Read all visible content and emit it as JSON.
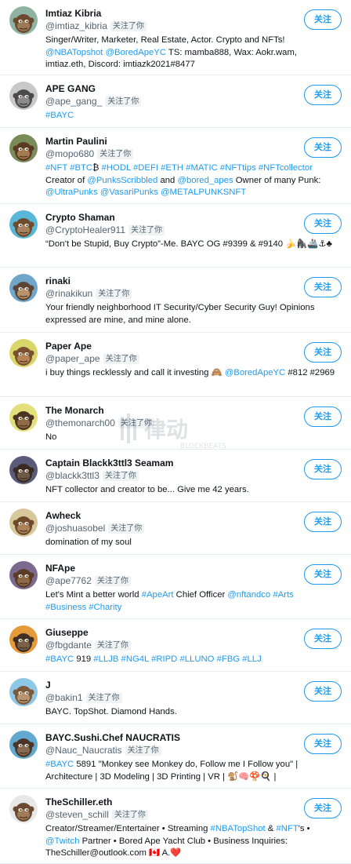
{
  "follow_label": "关注",
  "follows_you_label": "关注了你",
  "watermark": {
    "text": "律动",
    "subtext": "BLOCKBEATS"
  },
  "colors": {
    "link": "#1d9bf0",
    "divider": "#e6ecf0"
  },
  "users": [
    {
      "name": "Imtiaz Kibria",
      "handle": "@imtiaz_kibria",
      "icon": "ape-avatar-icon",
      "bio": [
        {
          "t": "Singer/Writer, Marketer, Real Estate, Actor. Crypto and NFTs! "
        },
        {
          "t": "@NBATopshot",
          "l": true
        },
        {
          "t": " "
        },
        {
          "t": "@BoredApeYC",
          "l": true
        },
        {
          "t": " TS: mamba888, Wax: Aokr.wam, imtiaz.eth, Discord: imtiazk2021#8477"
        }
      ]
    },
    {
      "name": "APE GANG",
      "handle": "@ape_gang_",
      "icon": "ape-avatar-icon",
      "bio": [
        {
          "t": "#BAYC",
          "l": true
        }
      ]
    },
    {
      "name": "Martin Paulini",
      "handle": "@mopo680",
      "icon": "ape-avatar-icon",
      "bio": [
        {
          "t": "#NFT",
          "l": true
        },
        {
          "t": " "
        },
        {
          "t": "#BTC",
          "l": true
        },
        {
          "t": "₿ "
        },
        {
          "t": "#HODL",
          "l": true
        },
        {
          "t": " "
        },
        {
          "t": "#DEFI",
          "l": true
        },
        {
          "t": " "
        },
        {
          "t": "#ETH",
          "l": true
        },
        {
          "t": " "
        },
        {
          "t": "#MATIC",
          "l": true
        },
        {
          "t": " "
        },
        {
          "t": "#NFTtips",
          "l": true
        },
        {
          "t": " "
        },
        {
          "t": "#NFTcollector",
          "l": true
        },
        {
          "t": " Creator of "
        },
        {
          "t": "@PunksScribbled",
          "l": true
        },
        {
          "t": " and "
        },
        {
          "t": "@bored_apes",
          "l": true
        },
        {
          "t": " Owner of many Punk: "
        },
        {
          "t": "@UltraPunks",
          "l": true
        },
        {
          "t": " "
        },
        {
          "t": "@VasariPunks",
          "l": true
        },
        {
          "t": " "
        },
        {
          "t": "@METALPUNKSNFT",
          "l": true
        }
      ]
    },
    {
      "name": "Crypto Shaman",
      "handle": "@CryptoHealer911",
      "icon": "ape-avatar-icon",
      "bio": [
        {
          "t": "“Don’t be Stupid, Buy Crypto”-Me. BAYC OG #9399 & #9140 🍌🦍🚢⚓♣"
        }
      ]
    },
    {
      "name": "rinaki",
      "handle": "@rinakikun",
      "icon": "ape-avatar-icon",
      "bio": [
        {
          "t": "Your friendly neighborhood IT Security/Cyber Security Guy! Opinions expressed are mine, and mine alone."
        }
      ]
    },
    {
      "name": "Paper Ape",
      "handle": "@paper_ape",
      "icon": "ape-avatar-icon",
      "bio": [
        {
          "t": "i buy things recklessly and call it investing 🙈 "
        },
        {
          "t": "@BoredApeYC",
          "l": true
        },
        {
          "t": " #812 #2969"
        }
      ]
    },
    {
      "name": "The Monarch",
      "handle": "@themonarch00",
      "icon": "ape-avatar-icon",
      "bio": [
        {
          "t": "No"
        }
      ]
    },
    {
      "name": "Captain Blackk3ttl3 Seamam",
      "handle": "@blackk3ttl3",
      "icon": "ape-avatar-icon",
      "bio": [
        {
          "t": "NFT collector and creator to be... Give me 42 years."
        }
      ]
    },
    {
      "name": "Awheck",
      "handle": "@joshuasobel",
      "icon": "ape-avatar-icon",
      "bio": [
        {
          "t": "domination of my soul"
        }
      ]
    },
    {
      "name": "NFApe",
      "handle": "@ape7762",
      "icon": "ape-avatar-icon",
      "bio": [
        {
          "t": "Let's Mint a better world "
        },
        {
          "t": "#ApeArt",
          "l": true
        },
        {
          "t": " Chief Officer "
        },
        {
          "t": "@nftandco",
          "l": true
        },
        {
          "t": " "
        },
        {
          "t": "#Arts",
          "l": true
        },
        {
          "t": " "
        },
        {
          "t": "#Business",
          "l": true
        },
        {
          "t": " "
        },
        {
          "t": "#Charity",
          "l": true
        }
      ]
    },
    {
      "name": "Giuseppe",
      "handle": "@fbgdante",
      "icon": "ape-avatar-icon",
      "bio": [
        {
          "t": "#BAYC",
          "l": true
        },
        {
          "t": " 919 "
        },
        {
          "t": "#LLJB",
          "l": true
        },
        {
          "t": " "
        },
        {
          "t": "#NG4L",
          "l": true
        },
        {
          "t": " "
        },
        {
          "t": "#RIPD",
          "l": true
        },
        {
          "t": " "
        },
        {
          "t": "#LLUNO",
          "l": true
        },
        {
          "t": " "
        },
        {
          "t": "#FBG",
          "l": true
        },
        {
          "t": " "
        },
        {
          "t": "#LLJ",
          "l": true
        }
      ]
    },
    {
      "name": "J",
      "handle": "@bakin1",
      "icon": "ape-avatar-icon",
      "bio": [
        {
          "t": "BAYC. TopShot. Diamond Hands."
        }
      ]
    },
    {
      "name": "BAYC.Sushi.Chef NAUCRATIS",
      "handle": "@Nauc_Naucratis",
      "icon": "ape-avatar-icon",
      "bio": [
        {
          "t": "#BAYC",
          "l": true
        },
        {
          "t": " 5891 \"Monkey see Monkey do, Follow me I Follow you\" | Architecture | 3D Modeling | 3D Printing | VR | 🐒🧠🍄🍳 |"
        }
      ]
    },
    {
      "name": "TheSchiller.eth",
      "handle": "@steven_schill",
      "icon": "ape-avatar-icon",
      "bio": [
        {
          "t": "Creator/Streamer/Entertainer • Streaming "
        },
        {
          "t": "#NBATopShot",
          "l": true
        },
        {
          "t": " & "
        },
        {
          "t": "#NFT",
          "l": true
        },
        {
          "t": "'s • "
        },
        {
          "t": "@Twitch",
          "l": true
        },
        {
          "t": " Partner • Bored Ape Yacht Club • Business Inquiries: TheSchiller@outlook.com 🇨🇦 A.❤️"
        }
      ]
    }
  ]
}
